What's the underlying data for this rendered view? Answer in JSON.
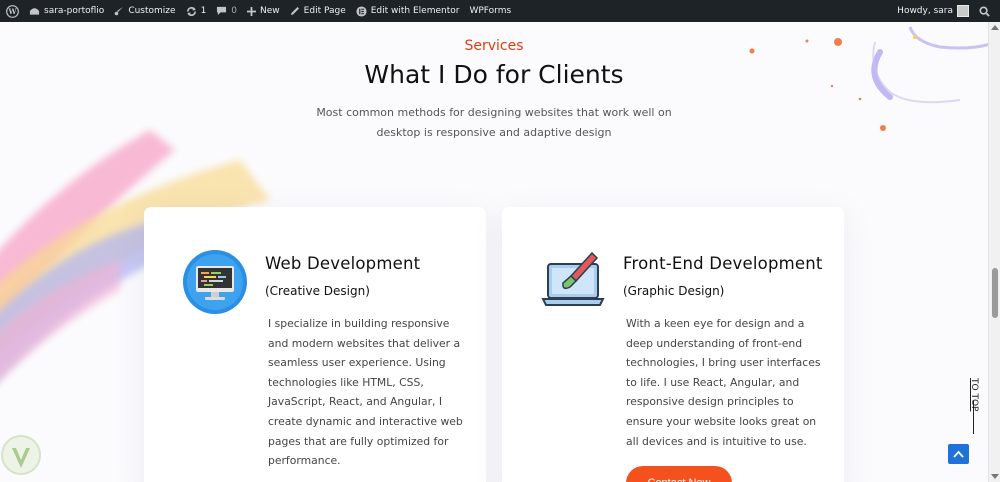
{
  "adminbar": {
    "site_name": "sara-portoflio",
    "customize": "Customize",
    "updates_count": "1",
    "comments_count": "0",
    "new": "New",
    "edit_page": "Edit Page",
    "elementor": "Edit with Elementor",
    "wpforms": "WPForms",
    "howdy": "Howdy, sara"
  },
  "section": {
    "eyebrow": "Services",
    "heading": "What I Do for Clients",
    "subtitle_line1": "Most common methods for designing websites that work well on",
    "subtitle_line2": "desktop is responsive and adaptive design"
  },
  "cards": [
    {
      "title": "Web Development",
      "subtitle": "(Creative Design)",
      "body": "I specialize in building responsive and modern websites that deliver a seamless user experience. Using technologies like HTML, CSS, JavaScript, React, and Angular, I create dynamic and interactive web pages that are fully optimized for performance.",
      "icon": "monitor-code-icon"
    },
    {
      "title": "Front-End Development",
      "subtitle": "(Graphic Design)",
      "body": "With a keen eye for design and a deep understanding of front-end technologies, I bring user interfaces to life. I use React, Angular, and responsive design principles to ensure your website looks great on all devices and is intuitive to use.",
      "icon": "laptop-brush-icon",
      "button": "Contact Now"
    }
  ],
  "totop": {
    "label": "TO TOP"
  },
  "colors": {
    "accent": "#e8390e",
    "button": "#f4511e",
    "adminbar": "#1d2327",
    "totop": "#1e73d8"
  }
}
